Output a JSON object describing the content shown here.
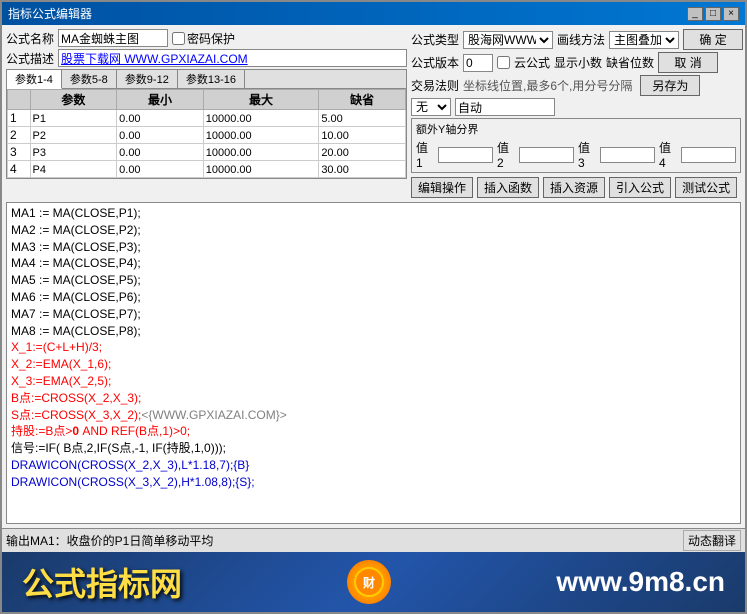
{
  "window": {
    "title": "指标公式编辑器",
    "controls": [
      "_",
      "□",
      "×"
    ]
  },
  "form": {
    "formula_name_label": "公式名称",
    "formula_name_value": "MA金蜘蛛主图",
    "password_label": "密码保护",
    "formula_desc_label": "公式描述",
    "formula_desc_value": "股票下载网 WWW.GPXIAZAI.COM",
    "formula_type_label": "公式类型",
    "formula_type_value": "股海网WWW.GU",
    "draw_method_label": "画线方法",
    "draw_method_value": "主图叠加",
    "confirm_btn": "确 定",
    "formula_version_label": "公式版本",
    "formula_version_value": "0",
    "cloud_label": "云公式",
    "decimal_label": "显示小数",
    "default_label": "缺省位数",
    "cancel_btn": "取 消",
    "saveas_btn": "另存为"
  },
  "tabs": {
    "items": [
      "参数1-4",
      "参数5-8",
      "参数9-12",
      "参数13-16"
    ]
  },
  "params_table": {
    "headers": [
      "",
      "参数",
      "最小",
      "最大",
      "缺省"
    ],
    "rows": [
      {
        "num": "1",
        "name": "P1",
        "min": "0.00",
        "max": "10000.00",
        "default": "5.00"
      },
      {
        "num": "2",
        "name": "P2",
        "min": "0.00",
        "max": "10000.00",
        "default": "10.00"
      },
      {
        "num": "3",
        "name": "P3",
        "min": "0.00",
        "max": "10000.00",
        "default": "20.00"
      },
      {
        "num": "4",
        "name": "P4",
        "min": "0.00",
        "max": "10000.00",
        "default": "30.00"
      }
    ]
  },
  "trade": {
    "trade_rule_label": "交易法则",
    "seat_label": "坐标线位置,最多6个,用分号分隔",
    "select_value": "无",
    "auto_value": "自动"
  },
  "yaxis": {
    "section_label": "额外Y轴分界",
    "val1_label": "值1",
    "val2_label": "值2",
    "val3_label": "值3",
    "val4_label": "值4"
  },
  "actions": {
    "edit_ops": "编辑操作",
    "insert_func": "插入函数",
    "insert_source": "插入资源",
    "import_formula": "引入公式",
    "test_formula": "测试公式"
  },
  "code": [
    {
      "text": "MA1 := MA(CLOSE,P1);",
      "style": "normal"
    },
    {
      "text": "MA2 := MA(CLOSE,P2);",
      "style": "normal"
    },
    {
      "text": "MA3 := MA(CLOSE,P3);",
      "style": "normal"
    },
    {
      "text": "MA4 := MA(CLOSE,P4);",
      "style": "normal"
    },
    {
      "text": "MA5 := MA(CLOSE,P5);",
      "style": "normal"
    },
    {
      "text": "MA6 := MA(CLOSE,P6);",
      "style": "normal"
    },
    {
      "text": "MA7 := MA(CLOSE,P7);",
      "style": "normal"
    },
    {
      "text": "MA8 := MA(CLOSE,P8);",
      "style": "normal"
    },
    {
      "text": "X_1:=(C+L+H)/3;",
      "style": "red"
    },
    {
      "text": "X_2:=EMA(X_1,6);",
      "style": "red"
    },
    {
      "text": "X_3:=EMA(X_2,5);",
      "style": "red"
    },
    {
      "text": "B点:=CROSS(X_2,X_3);",
      "style": "red"
    },
    {
      "text": "S点:=CROSS(X_3,X_2);<{WWW.GPXIAZAI.COM}>",
      "style": "red_comment"
    },
    {
      "text": "持股:=B点>0 AND REF(B点,1)>0;",
      "style": "red_bold"
    },
    {
      "text": "信号:=IF( B点,2,IF(S点,-1, IF(持股,1,0)));",
      "style": "normal"
    },
    {
      "text": "DRAWICON(CROSS(X_2,X_3),L*1.18,7);{B}",
      "style": "blue"
    },
    {
      "text": "DRAWICON(CROSS(X_3,X_2),H*1.08,8);{S};",
      "style": "blue"
    }
  ],
  "statusbar": {
    "output_text": "输出MA1：收盘价的P1日简单移动平均",
    "dynamic_translate": "动态翻译"
  },
  "watermark": {
    "left_text": "公式指标网",
    "right_text": "www.9m8.cn"
  }
}
